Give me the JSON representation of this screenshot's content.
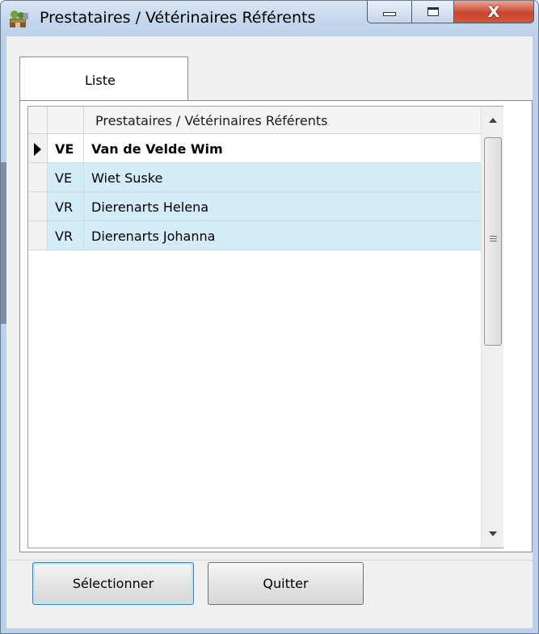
{
  "window": {
    "title": "Prestataires / Vétérinaires Référents",
    "close_glyph": "X"
  },
  "tabs": [
    {
      "label": "Liste",
      "active": true
    }
  ],
  "grid": {
    "column_header": "Prestataires / Vétérinaires Référents",
    "rows": [
      {
        "code": "VE",
        "name": "Van de Velde Wim",
        "current": true
      },
      {
        "code": "VE",
        "name": "Wiet Suske",
        "current": false
      },
      {
        "code": "VR",
        "name": "Dierenarts Helena",
        "current": false
      },
      {
        "code": "VR",
        "name": "Dierenarts Johanna",
        "current": false
      }
    ]
  },
  "buttons": {
    "select_label": "Sélectionner",
    "quit_label": "Quitter"
  },
  "colors": {
    "row_highlight": "#d4ebf8",
    "titlebar": "#c3d6ec",
    "close_button": "#c8462e"
  },
  "icons": {
    "app": "vet-app-icon",
    "minimize": "minimize-icon",
    "maximize": "maximize-icon",
    "close": "close-icon",
    "row_pointer": "current-row-pointer-icon",
    "scroll_up": "scroll-up-icon",
    "scroll_down": "scroll-down-icon"
  }
}
